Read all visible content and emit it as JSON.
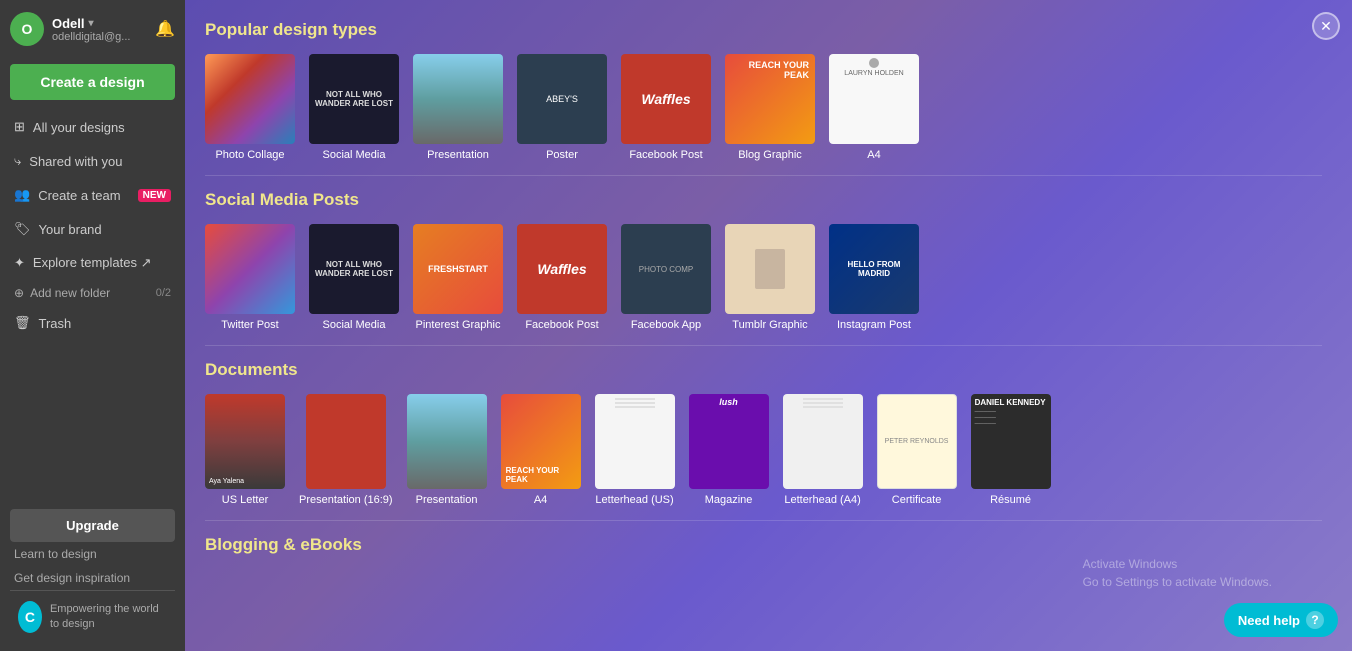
{
  "sidebar": {
    "user": {
      "name": "Odell",
      "email": "odelldigital@g...",
      "avatar_text": "O"
    },
    "create_button": "Create a design",
    "nav_items": [
      {
        "id": "all-designs",
        "label": "All your designs",
        "icon": "grid"
      },
      {
        "id": "shared",
        "label": "Shared with you",
        "icon": "share"
      },
      {
        "id": "create-team",
        "label": "Create a team",
        "icon": "users",
        "badge": "NEW"
      },
      {
        "id": "your-brand",
        "label": "Your brand",
        "icon": "tag"
      },
      {
        "id": "explore",
        "label": "Explore templates ↗",
        "icon": "compass"
      }
    ],
    "folder": {
      "label": "Add new folder",
      "count": "0/2"
    },
    "trash": "Trash",
    "upgrade_button": "Upgrade",
    "learn_link": "Learn to design",
    "inspiration_link": "Get design inspiration",
    "footer_text": "Empowering the world to design",
    "canva_logo": "C"
  },
  "main": {
    "sections": [
      {
        "id": "popular",
        "title": "Popular design types",
        "items": [
          {
            "label": "Photo Collage",
            "thumb_class": "thumb-photo-collage"
          },
          {
            "label": "Social Media",
            "thumb_class": "thumb-social-media",
            "thumb_text": "NOT ALL WHO WANDER ARE LOST"
          },
          {
            "label": "Presentation",
            "thumb_class": "thumb-presentation"
          },
          {
            "label": "Poster",
            "thumb_class": "thumb-poster",
            "thumb_text": "ABEY'S"
          },
          {
            "label": "Facebook Post",
            "thumb_class": "thumb-facebook-post",
            "thumb_text": "Waffles"
          },
          {
            "label": "Blog Graphic",
            "thumb_class": "thumb-blog-graphic",
            "thumb_text": "REACH YOUR PEAK"
          },
          {
            "label": "A4",
            "thumb_class": "thumb-a4",
            "thumb_text": "LAURYN HOLDEN"
          }
        ]
      },
      {
        "id": "social",
        "title": "Social Media Posts",
        "items": [
          {
            "label": "Twitter Post",
            "thumb_class": "thumb-twitter"
          },
          {
            "label": "Social Media",
            "thumb_class": "thumb-social-media",
            "thumb_text": "NOT ALL WHO WANDER ARE LOST"
          },
          {
            "label": "Pinterest Graphic",
            "thumb_class": "thumb-pinterest",
            "thumb_text": "FRESHSTART"
          },
          {
            "label": "Facebook Post",
            "thumb_class": "thumb-fb-post",
            "thumb_text": "Waffles"
          },
          {
            "label": "Facebook App",
            "thumb_class": "thumb-facebook-app",
            "thumb_text": "PHOTO COMP"
          },
          {
            "label": "Tumblr Graphic",
            "thumb_class": "thumb-tumblr",
            "thumb_text": ""
          },
          {
            "label": "Instagram Post",
            "thumb_class": "thumb-instagram",
            "thumb_text": "HELLO FROM MADRID"
          }
        ]
      },
      {
        "id": "documents",
        "title": "Documents",
        "items": [
          {
            "label": "US Letter",
            "thumb_class": "thumb-us-letter",
            "thumb_text": "Aya Yalena"
          },
          {
            "label": "Presentation (16:9)",
            "thumb_class": "thumb-pres169",
            "thumb_text": ""
          },
          {
            "label": "Presentation",
            "thumb_class": "thumb-pres"
          },
          {
            "label": "A4",
            "thumb_class": "thumb-a4-doc",
            "thumb_text": "REACH YOUR PEAK"
          },
          {
            "label": "Letterhead (US)",
            "thumb_class": "thumb-letterhead",
            "thumb_text": ""
          },
          {
            "label": "Magazine",
            "thumb_class": "thumb-magazine",
            "thumb_text": "lush"
          },
          {
            "label": "Letterhead (A4)",
            "thumb_class": "thumb-letterhead-a4",
            "thumb_text": ""
          },
          {
            "label": "Certificate",
            "thumb_class": "thumb-certificate",
            "thumb_text": "PETER REYNOLDS"
          },
          {
            "label": "Résumé",
            "thumb_class": "thumb-resume",
            "thumb_text": "DANIEL KENNEDY"
          }
        ]
      },
      {
        "id": "blogging",
        "title": "Blogging & eBooks",
        "items": []
      }
    ]
  },
  "help": {
    "label": "Need help",
    "icon": "?"
  },
  "activate_windows": {
    "line1": "Activate Windows",
    "line2": "Go to Settings to activate Windows."
  }
}
